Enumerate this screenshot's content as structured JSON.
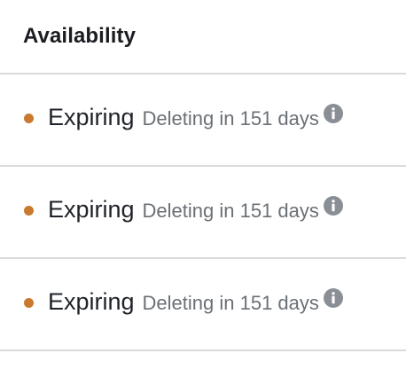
{
  "column": {
    "header": "Availability"
  },
  "rows": [
    {
      "status": "Expiring",
      "detail": "Deleting in 151 days",
      "icon": "info-icon"
    },
    {
      "status": "Expiring",
      "detail": "Deleting in 151 days",
      "icon": "info-icon"
    },
    {
      "status": "Expiring",
      "detail": "Deleting in 151 days",
      "icon": "info-icon"
    }
  ],
  "colors": {
    "status_dot": "#c97a2e",
    "divider": "#d9dadc",
    "muted_text": "#6b7076",
    "icon": "#8a8f96"
  }
}
